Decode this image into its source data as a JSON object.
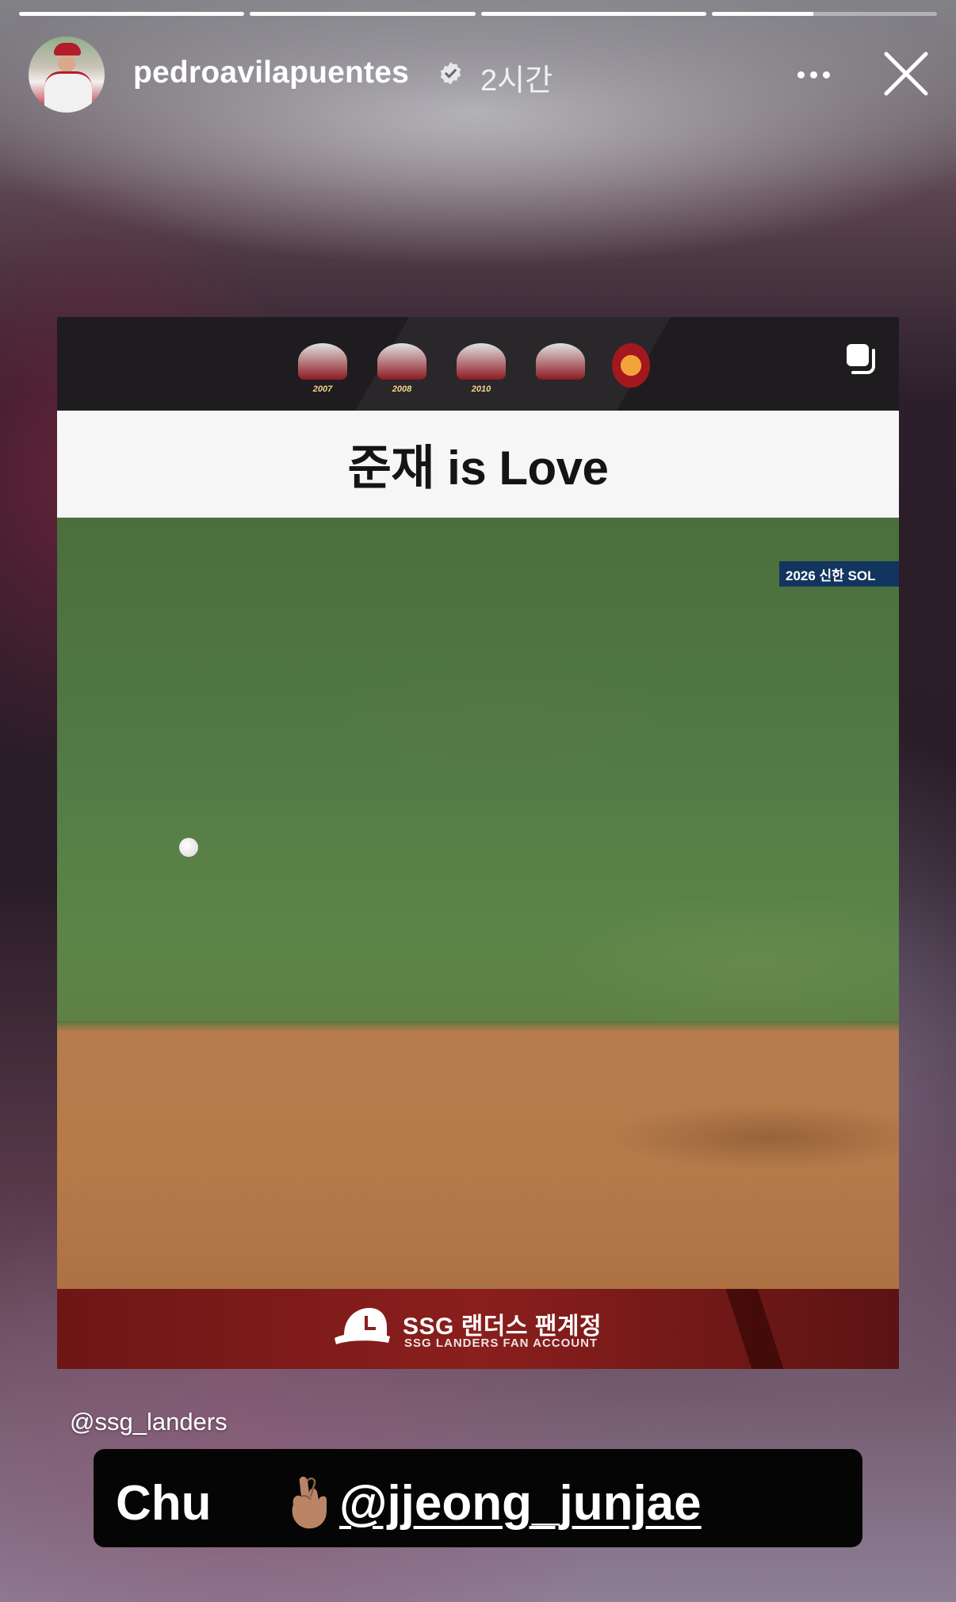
{
  "story": {
    "segments": [
      {
        "progress": 1.0
      },
      {
        "progress": 1.0
      },
      {
        "progress": 1.0
      },
      {
        "progress": 0.45
      }
    ]
  },
  "header": {
    "username": "pedroavilapuentes",
    "timestamp": "2시간",
    "verified_icon": "verified-badge-icon",
    "more_icon": "more-dots-icon",
    "close_icon": "close-icon"
  },
  "shared_post": {
    "title": "준재 is Love",
    "scoreboard_text": "2026 신한 SOL",
    "emblem_years": [
      "2007",
      "2008",
      "2010",
      "",
      ""
    ],
    "footer_main": "SSG 랜더스 팬계정",
    "footer_sub": "SSG LANDERS FAN ACCOUNT"
  },
  "stickers": {
    "mention_source": "@ssg_landers",
    "caption_word": "Chu",
    "caption_emoji": "🤞",
    "caption_mention": "@jjeong_junjae"
  },
  "colors": {
    "footer_red": "#8a1f1d",
    "scoreboard_blue": "#12355f",
    "field_green": "#527945",
    "infield_dirt": "#b77b4a"
  }
}
